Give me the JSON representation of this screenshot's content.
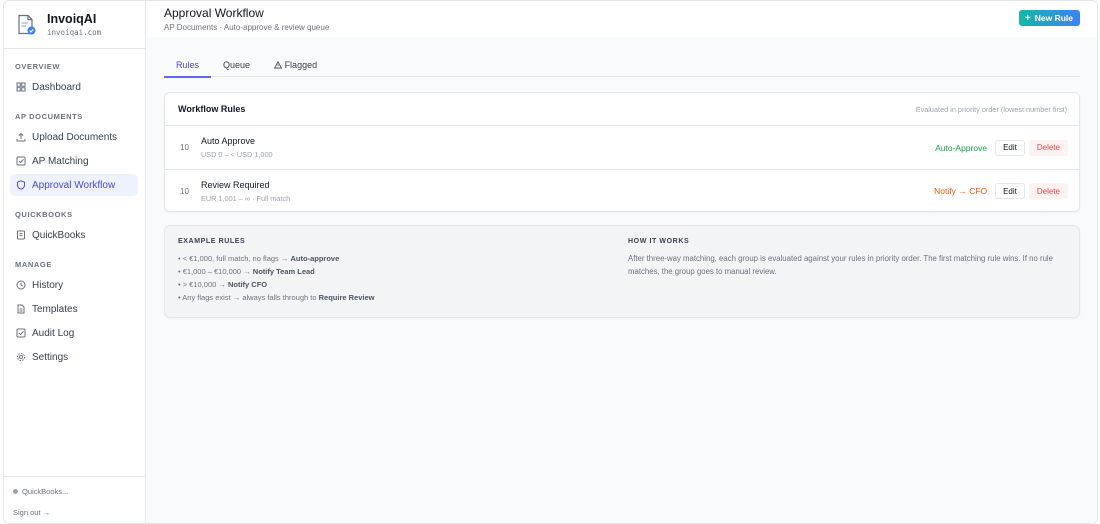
{
  "brand": {
    "name": "InvoiqAI",
    "domain": "invoiqai.com"
  },
  "sidebar": {
    "sections": [
      {
        "label": "OVERVIEW",
        "items": [
          {
            "label": "Dashboard",
            "icon": "grid-icon"
          }
        ]
      },
      {
        "label": "AP DOCUMENTS",
        "items": [
          {
            "label": "Upload Documents",
            "icon": "upload-icon"
          },
          {
            "label": "AP Matching",
            "icon": "check-square-icon"
          },
          {
            "label": "Approval Workflow",
            "icon": "shield-icon",
            "active": true
          }
        ]
      },
      {
        "label": "QUICKBOOKS",
        "items": [
          {
            "label": "QuickBooks",
            "icon": "book-icon"
          }
        ]
      },
      {
        "label": "MANAGE",
        "items": [
          {
            "label": "History",
            "icon": "clock-icon"
          },
          {
            "label": "Templates",
            "icon": "file-icon"
          },
          {
            "label": "Audit Log",
            "icon": "check-square-icon"
          },
          {
            "label": "Settings",
            "icon": "gear-icon"
          }
        ]
      }
    ],
    "footer": {
      "quickbooks_status": "QuickBooks...",
      "sign_out": "Sign out →"
    }
  },
  "header": {
    "title": "Approval Workflow",
    "subtitle": "AP Documents · Auto-approve & review queue",
    "new_rule_button": "New Rule"
  },
  "tabs": [
    {
      "label": "Rules",
      "active": true
    },
    {
      "label": "Queue"
    },
    {
      "label": "Flagged",
      "icon": "warning-icon"
    }
  ],
  "workflow_rules": {
    "title": "Workflow Rules",
    "note": "Evaluated in priority order (lowest number first)",
    "edit_label": "Edit",
    "delete_label": "Delete",
    "rules": [
      {
        "priority": "10",
        "name": "Auto Approve",
        "condition": "USD 0 – < USD 1,000",
        "action": "Auto-Approve",
        "action_color": "#16a34a"
      },
      {
        "priority": "10",
        "name": "Review Required",
        "condition": "EUR 1,001 – ∞ · Full match",
        "action": "Notify → CFO",
        "action_color": "#ea580c"
      }
    ]
  },
  "example_rules": {
    "heading": "EXAMPLE RULES",
    "items": [
      {
        "prefix": "• < €1,000, full match, no flags →",
        "bold": "Auto-approve"
      },
      {
        "prefix": "• €1,000 – €10,000 →",
        "bold": "Notify Team Lead"
      },
      {
        "prefix": "• > €10,000 →",
        "bold": "Notify CFO"
      },
      {
        "prefix": "• Any flags exist → always falls through to",
        "bold": "Require Review"
      }
    ]
  },
  "how_it_works": {
    "heading": "HOW IT WORKS",
    "text": "After three-way matching, each group is evaluated against your rules in priority order. The first matching rule wins. If no rule matches, the group goes to manual review."
  },
  "colors": {
    "accent": "#6366f1",
    "active_nav_bg": "#eef2ff",
    "delete": "#ef4444",
    "button_gradient_start": "#14b8a6",
    "button_gradient_end": "#3b82f6"
  }
}
